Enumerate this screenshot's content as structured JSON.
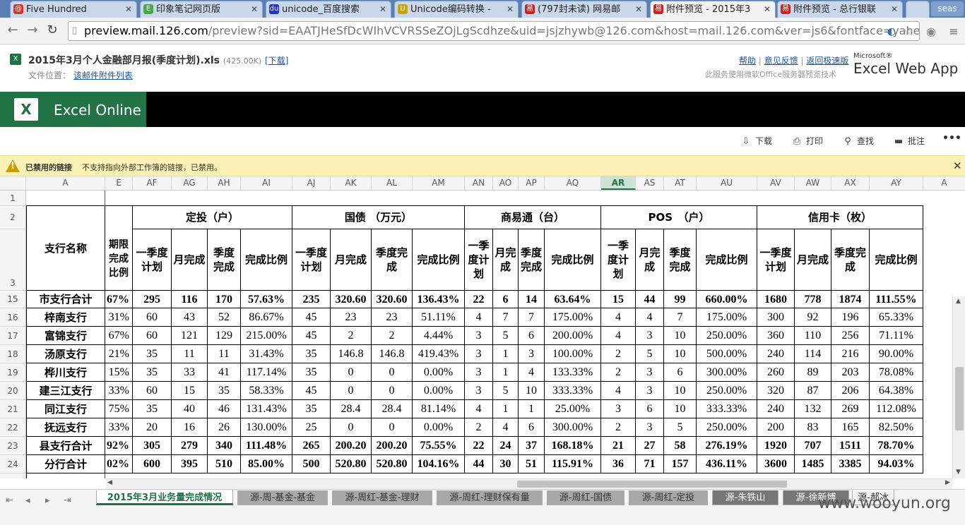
{
  "browser": {
    "tabs": [
      {
        "label": "Five Hundred",
        "icon": "mail-red-icon"
      },
      {
        "label": "印象笔记网页版",
        "icon": "evernote-icon"
      },
      {
        "label": "unicode_百度搜索",
        "icon": "baidu-icon"
      },
      {
        "label": "Unicode编码转换 -",
        "icon": "page-icon"
      },
      {
        "label": "(797封未读) 网易邮",
        "icon": "netease-icon"
      },
      {
        "label": "附件预览 - 2015年3",
        "icon": "netease-icon"
      },
      {
        "label": "附件预览 - 总行银联",
        "icon": "netease-icon"
      }
    ],
    "profile_label": "seas",
    "url_host": "preview.mail.126.com",
    "url_rest": "/preview?sid=EAATJHeSfDcWIhVCVRSSeZOjLgScdhze&uid=jsjzhywb@126.com&host=mail.126.com&ver=js6&fontface=yahei&style=23&"
  },
  "mail_header": {
    "file_name": "2015年3月个人金融部月报(季度计划).xls",
    "file_size": "(425.00K)",
    "download_link": "[下载]",
    "location_label": "文件位置：",
    "location_link": "该邮件附件列表",
    "help": "帮助",
    "feedback": "意见反馈",
    "back_fast": "返回极速版",
    "service_note": "此服务使用微软Office服务器预览技术",
    "ms_label": "Microsoft®",
    "excel_web_app": "Excel Web App"
  },
  "excel": {
    "brand": "Excel Online",
    "commands": [
      {
        "label": "下载",
        "icon": "download-icon"
      },
      {
        "label": "打印",
        "icon": "print-icon"
      },
      {
        "label": "查找",
        "icon": "search-icon"
      },
      {
        "label": "批注",
        "icon": "comment-icon"
      },
      {
        "label": "•••",
        "icon": "more-icon"
      }
    ],
    "warning_title": "已禁用的链接",
    "warning_message": "不支持指向外部工作簿的链接，已禁用。"
  },
  "grid": {
    "column_headers": [
      "A",
      "E",
      "AF",
      "AG",
      "AH",
      "AI",
      "AJ",
      "AK",
      "AL",
      "AM",
      "AN",
      "AO",
      "AP",
      "AQ",
      "AR",
      "AS",
      "AT",
      "AU",
      "AV",
      "AW",
      "AX",
      "AY",
      "A"
    ],
    "selected_column": "AR",
    "row_numbers": [
      "1",
      "2",
      "3",
      "15",
      "16",
      "17",
      "18",
      "19",
      "20",
      "21",
      "22",
      "23",
      "24"
    ],
    "group_headers": [
      "定投（户）",
      "国债 （万元）",
      "商易通（台）",
      "POS　（户）",
      "信用卡（枚）"
    ],
    "branch_header": "支行名称",
    "partial_header": "期限完成比例",
    "sub_headers": [
      "一季度计划",
      "月完成",
      "季度完成",
      "完成比例",
      "一季度计划",
      "月完成",
      "季度完成",
      "完成比例",
      "一季度计划",
      "月完成",
      "季度完成",
      "完成比例",
      "一季度计划",
      "月完成",
      "季度完成",
      "完成比例",
      "一季度计划",
      "月完成",
      "季度完成",
      "完成比例"
    ],
    "rows": [
      {
        "name": "市支行合计",
        "bold": true,
        "cells": [
          "67%",
          "295",
          "116",
          "170",
          "57.63%",
          "235",
          "320.60",
          "320.60",
          "136.43%",
          "22",
          "6",
          "14",
          "63.64%",
          "15",
          "44",
          "99",
          "660.00%",
          "1680",
          "778",
          "1874",
          "111.55%"
        ]
      },
      {
        "name": "梓南支行",
        "bold": false,
        "cells": [
          "31%",
          "60",
          "43",
          "52",
          "86.67%",
          "45",
          "23",
          "23",
          "51.11%",
          "4",
          "7",
          "7",
          "175.00%",
          "4",
          "4",
          "7",
          "175.00%",
          "300",
          "92",
          "196",
          "65.33%"
        ]
      },
      {
        "name": "富锦支行",
        "bold": false,
        "cells": [
          "67%",
          "60",
          "121",
          "129",
          "215.00%",
          "45",
          "2",
          "2",
          "4.44%",
          "3",
          "5",
          "6",
          "200.00%",
          "4",
          "3",
          "10",
          "250.00%",
          "360",
          "110",
          "256",
          "71.11%"
        ]
      },
      {
        "name": "汤原支行",
        "bold": false,
        "cells": [
          "21%",
          "35",
          "11",
          "11",
          "31.43%",
          "35",
          "146.8",
          "146.8",
          "419.43%",
          "3",
          "1",
          "3",
          "100.00%",
          "2",
          "5",
          "10",
          "500.00%",
          "240",
          "114",
          "216",
          "90.00%"
        ]
      },
      {
        "name": "桦川支行",
        "bold": false,
        "cells": [
          "15%",
          "35",
          "33",
          "41",
          "117.14%",
          "35",
          "0",
          "0",
          "0.00%",
          "3",
          "1",
          "4",
          "133.33%",
          "2",
          "3",
          "6",
          "300.00%",
          "260",
          "89",
          "203",
          "78.08%"
        ]
      },
      {
        "name": "建三江支行",
        "bold": false,
        "cells": [
          "33%",
          "60",
          "15",
          "35",
          "58.33%",
          "45",
          "0",
          "0",
          "0.00%",
          "3",
          "5",
          "10",
          "333.33%",
          "4",
          "3",
          "10",
          "250.00%",
          "320",
          "87",
          "206",
          "64.38%"
        ]
      },
      {
        "name": "同江支行",
        "bold": false,
        "cells": [
          "75%",
          "35",
          "40",
          "46",
          "131.43%",
          "35",
          "28.4",
          "28.4",
          "81.14%",
          "4",
          "1",
          "1",
          "25.00%",
          "3",
          "6",
          "10",
          "333.33%",
          "240",
          "132",
          "269",
          "112.08%"
        ]
      },
      {
        "name": "抚远支行",
        "bold": false,
        "cells": [
          "33%",
          "20",
          "16",
          "26",
          "130.00%",
          "25",
          "0",
          "0",
          "0.00%",
          "2",
          "4",
          "6",
          "300.00%",
          "2",
          "3",
          "5",
          "250.00%",
          "200",
          "83",
          "165",
          "82.50%"
        ]
      },
      {
        "name": "县支行合计",
        "bold": true,
        "cells": [
          "92%",
          "305",
          "279",
          "340",
          "111.48%",
          "265",
          "200.20",
          "200.20",
          "75.55%",
          "22",
          "24",
          "37",
          "168.18%",
          "21",
          "27",
          "58",
          "276.19%",
          "1920",
          "707",
          "1511",
          "78.70%"
        ]
      },
      {
        "name": "分行合计",
        "bold": true,
        "cells": [
          "02%",
          "600",
          "395",
          "510",
          "85.00%",
          "500",
          "520.80",
          "520.80",
          "104.16%",
          "44",
          "30",
          "51",
          "115.91%",
          "36",
          "71",
          "157",
          "436.11%",
          "3600",
          "1485",
          "3385",
          "94.03%"
        ]
      }
    ]
  },
  "sheets": [
    {
      "label": "2015年3月业务量完成情况",
      "active": true
    },
    {
      "label": "源-周-基金-基金",
      "active": false
    },
    {
      "label": "源-周红-基金-理财",
      "active": false
    },
    {
      "label": "源-周红-理财保有量",
      "active": false
    },
    {
      "label": "源-周红-国债",
      "active": false
    },
    {
      "label": "源-周红-定投",
      "active": false
    },
    {
      "label": "源-朱铁山",
      "active": false
    },
    {
      "label": "源-徐新博",
      "active": false
    },
    {
      "label": "源-郝冰",
      "active": false
    }
  ],
  "watermark": "www.wooyun.org"
}
